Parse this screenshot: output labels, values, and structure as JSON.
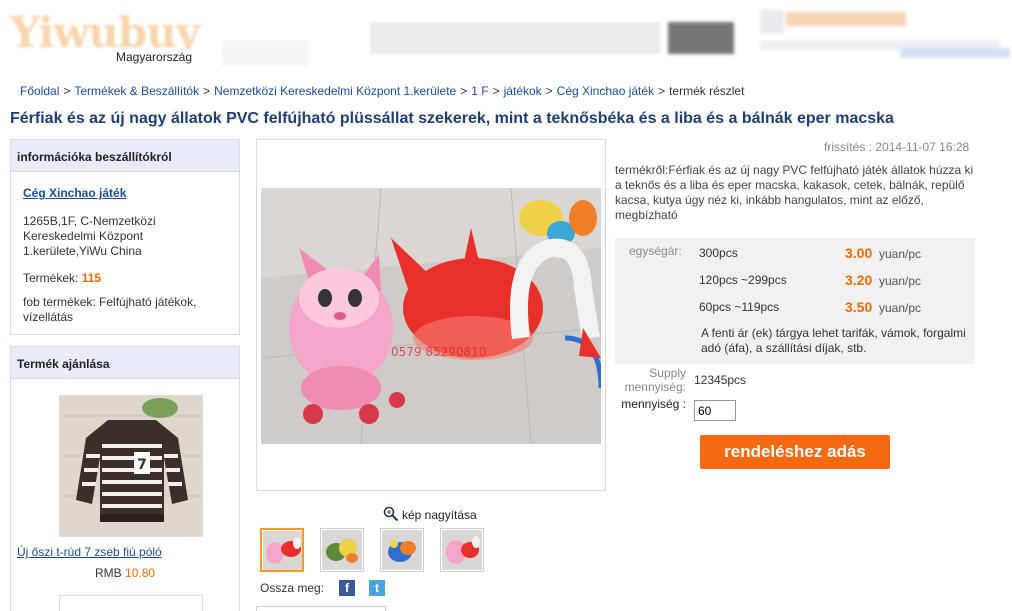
{
  "header": {
    "logo_text": "Yiwubuy",
    "country": "Magyarország"
  },
  "breadcrumb": {
    "items": [
      "Főoldal",
      "Termékek & Beszállítók",
      "Nemzetközi Kereskedelmi Központ 1.kerülete",
      "1 F",
      "játékok",
      "Cég Xinchao játék"
    ],
    "current": "termék részlet",
    "separator": ">"
  },
  "title": "Férfiak és az új nagy állatok PVC felfújható plüssállat szekerek, mint a teknősbéka és a liba és a bálnák eper macska",
  "supplier": {
    "heading": "információka beszállítókról",
    "name": "Cég Xinchao játék",
    "address": "1265B,1F, C-Nemzetközi Kereskedelmi Központ 1.kerülete,YiWu China",
    "products_label": "Termékek:",
    "products_count": "115",
    "fob_text": "fob termékek: Felfújható játékok, vízellátás"
  },
  "recommend": {
    "heading": "Termék ajánlása",
    "item_name": "Új őszi t-rúd 7 zseb fiú póló",
    "currency": "RMB",
    "price": "10.80"
  },
  "gallery": {
    "zoom_label": "kép nagyítása",
    "share_label": "Ossza meg:",
    "facebook_icon": "f",
    "twitter_icon": "t"
  },
  "product": {
    "updated": "frissítés : 2014-11-07 16:28",
    "description": "termékről:Férfiak és az új nagy PVC felfújható játék állatok húzza ki a teknős és a liba és eper macska, kakasok, cetek, bálnák, repülő kacsa, kutya úgy néz ki, inkább hangulatos, mint az előző, megbízható",
    "price_label": "egységár:",
    "tiers": [
      {
        "qty": "300pcs",
        "price": "3.00",
        "unit": "yuan/pc"
      },
      {
        "qty": "120pcs ~299pcs",
        "price": "3.20",
        "unit": "yuan/pc"
      },
      {
        "qty": "60pcs ~119pcs",
        "price": "3.50",
        "unit": "yuan/pc"
      }
    ],
    "price_note": "A fenti ár (ek) tárgya lehet tarifák, vámok, forgalmi adó (áfa), a szállítási díjak, stb.",
    "supply_label": "Supply mennyiség:",
    "supply_value": "12345pcs",
    "qty_label": "mennyiség :",
    "qty_value": "60",
    "order_button": "rendeléshez adás"
  },
  "colors": {
    "accent": "#f56a10",
    "link": "#1a4b9b",
    "title": "#1f3f73",
    "panel_head": "#e8ecf7"
  }
}
